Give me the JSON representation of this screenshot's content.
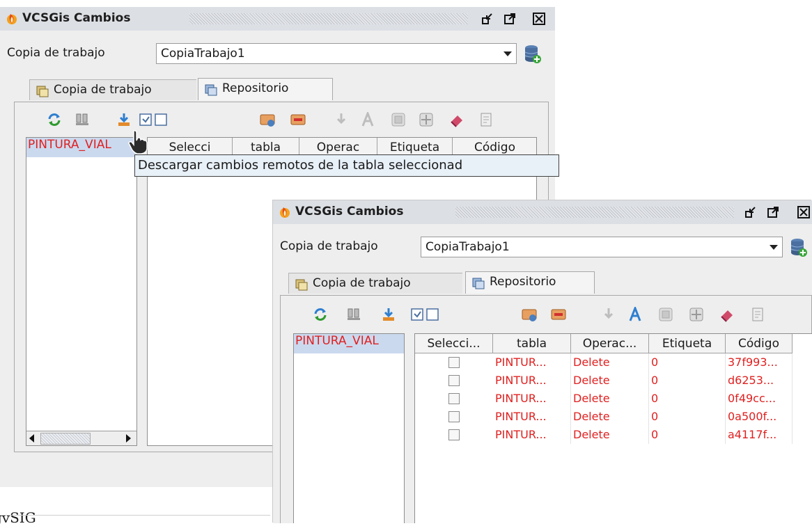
{
  "window": {
    "title": "VCSGis Cambios",
    "working_copy_label": "Copia de trabajo",
    "working_copy_value": "CopiaTrabajo1",
    "tabs": [
      {
        "label": "Copia de trabajo"
      },
      {
        "label": "Repositorio"
      }
    ],
    "list_item": "PINTURA_VIAL",
    "tooltip": "Descargar cambios remotos de la tabla seleccionad",
    "columns": [
      "Selecci...",
      "tabla",
      "Operac...",
      "Etiqueta",
      "Código"
    ],
    "back_columns": [
      "Selecci",
      "tabla",
      "Operac",
      "Etiqueta",
      "Código"
    ],
    "rows": [
      {
        "tabla": "PINTUR...",
        "operacion": "Delete",
        "etiqueta": "0",
        "codigo": "37f993..."
      },
      {
        "tabla": "PINTUR...",
        "operacion": "Delete",
        "etiqueta": "0",
        "codigo": "d6253..."
      },
      {
        "tabla": "PINTUR...",
        "operacion": "Delete",
        "etiqueta": "0",
        "codigo": "0f49cc..."
      },
      {
        "tabla": "PINTUR...",
        "operacion": "Delete",
        "etiqueta": "0",
        "codigo": "0a500f..."
      },
      {
        "tabla": "PINTUR...",
        "operacion": "Delete",
        "etiqueta": "0",
        "codigo": "a4117f..."
      }
    ]
  },
  "desktop": {
    "app_label": "gvSIG"
  },
  "icons": {
    "title": "gvsig-flame-icon",
    "minimize": "minimize-icon",
    "maximize": "maximize-icon",
    "close": "close-icon",
    "db": "database-add-icon",
    "tools": [
      "refresh-icon",
      "commit-icon",
      "download-icon",
      "check-all-icon",
      "uncheck-all-icon",
      "add-repo-icon",
      "remove-repo-icon",
      "update-icon",
      "text-icon",
      "window-icon",
      "expand-icon",
      "erase-icon",
      "report-icon"
    ]
  },
  "colors": {
    "accent_red": "#e02020",
    "selection_blue": "#cbd9ee",
    "title_bg": "#dcdfe4"
  }
}
